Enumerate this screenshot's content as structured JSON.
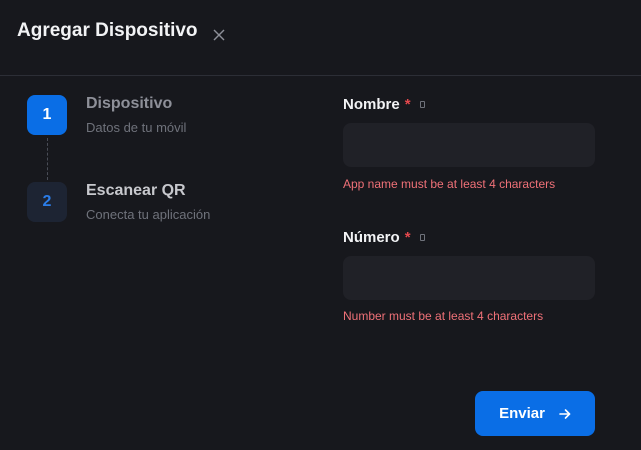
{
  "modal": {
    "title": "Agregar Dispositivo",
    "close_icon": "close-icon"
  },
  "steps": [
    {
      "number": "1",
      "title": "Dispositivo",
      "subtitle": "Datos de tu móvil",
      "state": "active"
    },
    {
      "number": "2",
      "title": "Escanear QR",
      "subtitle": "Conecta tu aplicación",
      "state": "inactive"
    }
  ],
  "form": {
    "name": {
      "label": "Nombre",
      "required_mark": "*",
      "value": "",
      "error": "App name must be at least 4 characters"
    },
    "number": {
      "label": "Número",
      "required_mark": "*",
      "value": "",
      "error": "Number must be at least 4 characters"
    },
    "submit_label": "Enviar",
    "submit_icon": "arrow-right-icon"
  },
  "colors": {
    "background": "#17181d",
    "accent": "#0a6ee6",
    "error": "#f07178",
    "required": "#e5484d",
    "input_bg": "#202127"
  }
}
